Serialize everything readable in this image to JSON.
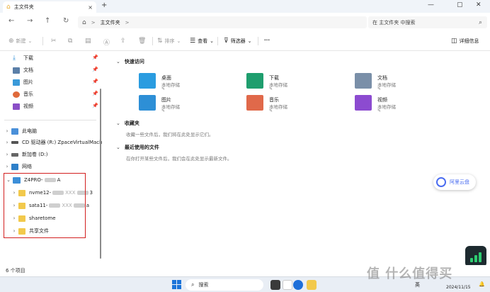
{
  "window": {
    "tab_title": "主文件夹",
    "tab_close": "×",
    "new_tab": "+",
    "controls": [
      "—",
      "▢",
      "✕"
    ]
  },
  "nav": {
    "breadcrumb": "主文件夹",
    "breadcrumb_sep": ">",
    "search_placeholder": "在 主文件夹 中搜索"
  },
  "toolbar": {
    "new_label": "新建",
    "sort_label": "排序",
    "view_label": "查看",
    "filter_label": "筛选器",
    "more_label": "···",
    "details_label": "详细信息"
  },
  "sidebar": {
    "pinned": [
      {
        "label": "下载",
        "color": "#2e8fd8"
      },
      {
        "label": "文档",
        "color": "#5b7fa8"
      },
      {
        "label": "图片",
        "color": "#3a9ad9"
      },
      {
        "label": "音乐",
        "color": "#e06a3b"
      },
      {
        "label": "视频",
        "color": "#8a4fc7"
      }
    ],
    "this_pc": "此电脑",
    "cd_drive": "CD 驱动器 (R:) ZpaceVirtualMach",
    "new_volume": "新加卷 (D:)",
    "network": "网络",
    "device_a": "Z4PRO-",
    "device_b": "A",
    "share1_a": "nvme12-",
    "share1_b": "XXX",
    "share1_c": "3",
    "share2_a": "sata11-",
    "share2_b": "XXX",
    "share2_c": "a",
    "share3": "sharetome",
    "share4": "共享文件"
  },
  "content": {
    "quick_access": "快速访问",
    "favorites": "收藏夹",
    "favorites_empty": "收藏一些文件后，我们将在此处显示它们。",
    "recent": "最近使用的文件",
    "recent_empty": "在你打开某些文件后，我们会在此处显示最新文件。",
    "local_storage": "本地存储",
    "pin_glyph": "✎",
    "tiles": [
      {
        "name": "桌面",
        "color": "#2a9ce0"
      },
      {
        "name": "下载",
        "color": "#1f9e6e"
      },
      {
        "name": "文档",
        "color": "#7a8fa8"
      },
      {
        "name": "图片",
        "color": "#2d8fd6"
      },
      {
        "name": "音乐",
        "color": "#e0694a"
      },
      {
        "name": "视频",
        "color": "#8c4bd0"
      }
    ]
  },
  "cloud_widget": {
    "label": "阿里云盘"
  },
  "status": {
    "item_count": "6 个项目"
  },
  "taskbar": {
    "search": "搜索",
    "lang": "英",
    "date": "2024/11/15"
  },
  "watermark": "值 什么值得买"
}
